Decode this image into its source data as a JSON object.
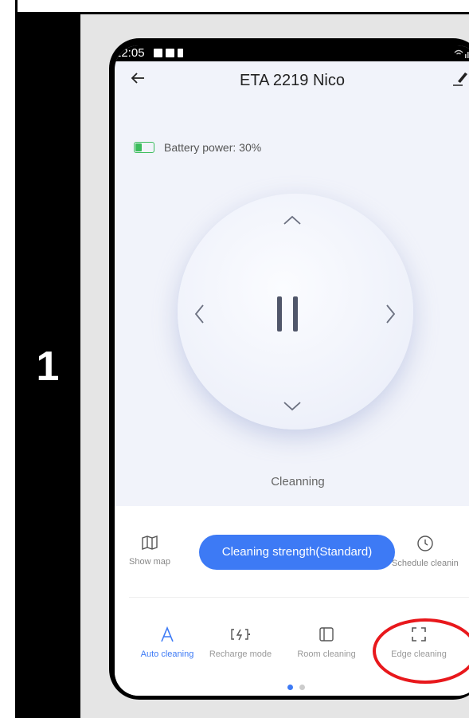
{
  "step": {
    "number": "1"
  },
  "status_bar": {
    "time": "12:05"
  },
  "header": {
    "title": "ETA 2219 Nico"
  },
  "battery": {
    "label": "Battery power: 30%",
    "level_percent": 30,
    "color": "#3bbd5c"
  },
  "control": {
    "status": "Cleanning"
  },
  "actions": {
    "show_map": "Show map",
    "strength": "Cleaning strength(Standard)",
    "schedule": "Schedule cleanin"
  },
  "modes": {
    "auto": "Auto cleaning",
    "recharge": "Recharge mode",
    "room": "Room cleaning",
    "edge": "Edge cleaning"
  },
  "pagination": {
    "pages": 2,
    "current": 1
  },
  "colors": {
    "accent": "#3d7af5",
    "highlight": "#e8181c"
  },
  "icons": [
    "back-arrow-icon",
    "edit-icon",
    "battery-icon",
    "arrow-up-icon",
    "arrow-down-icon",
    "arrow-left-icon",
    "arrow-right-icon",
    "pause-icon",
    "map-icon",
    "clock-icon",
    "auto-mode-icon",
    "recharge-icon",
    "room-icon",
    "edge-icon"
  ]
}
